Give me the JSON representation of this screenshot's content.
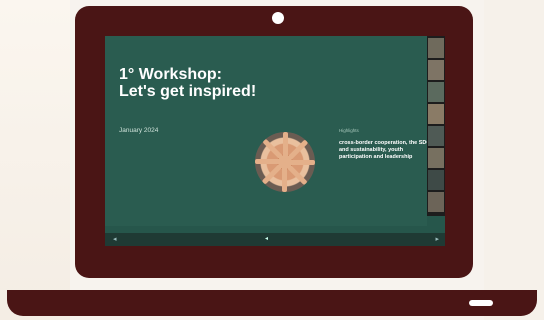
{
  "slide": {
    "title": "1° Workshop: Let's get inspired!",
    "date": "January 2024",
    "highlights_label": "Highlights",
    "highlights_text": "cross-border cooperation, the SDGs and sustainability, youth participation and leadership",
    "footnote": ""
  },
  "controls": {
    "center_label": "",
    "left_icon": "chevron-left-icon",
    "right_icon": "chevron-right-icon"
  },
  "colors": {
    "laptop": "#4a1515",
    "slide_bg": "#2a5c50",
    "control_bar": "#1f3a34"
  },
  "participant_icons": [
    "person-video-icon",
    "person-video-icon",
    "person-video-icon",
    "person-video-icon",
    "person-video-icon",
    "person-video-icon",
    "person-video-icon",
    "person-video-icon"
  ]
}
